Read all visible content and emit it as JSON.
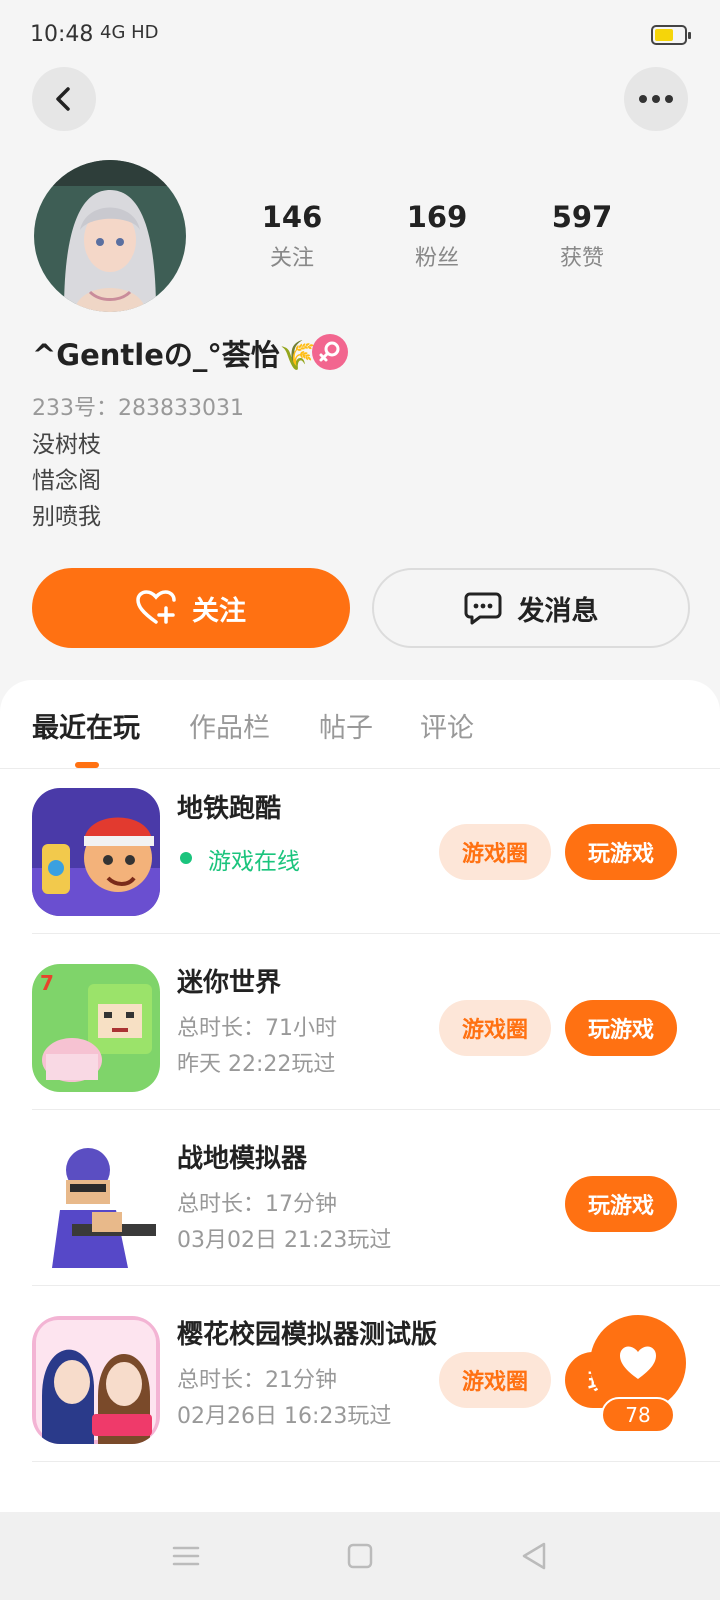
{
  "status_bar": {
    "time": "10:48",
    "network": "4G HD"
  },
  "profile": {
    "stats": [
      {
        "value": "146",
        "label": "关注"
      },
      {
        "value": "169",
        "label": "粉丝"
      },
      {
        "value": "597",
        "label": "获赞"
      }
    ],
    "nickname": "^Gentleの_°荟怡🌾",
    "uid": "233号：283833031",
    "bio": [
      "没树枝",
      "惜念阁",
      "别喷我"
    ],
    "follow_label": "关注",
    "message_label": "发消息"
  },
  "tabs": [
    {
      "label": "最近在玩",
      "active": true
    },
    {
      "label": "作品栏"
    },
    {
      "label": "帖子"
    },
    {
      "label": "评论"
    }
  ],
  "games": [
    {
      "name": "地铁跑酷",
      "status": "游戏在线",
      "circle_label": "游戏圈",
      "play_label": "玩游戏"
    },
    {
      "name": "迷你世界",
      "duration": "总时长：71小时",
      "last_played": "昨天 22:22玩过",
      "circle_label": "游戏圈",
      "play_label": "玩游戏"
    },
    {
      "name": "战地模拟器",
      "duration": "总时长：17分钟",
      "last_played": "03月02日 21:23玩过",
      "play_label": "玩游戏"
    },
    {
      "name": "樱花校园模拟器测试版",
      "duration": "总时长：21分钟",
      "last_played": "02月26日 16:23玩过",
      "circle_label": "游戏圈",
      "play_label": "玩游戏"
    }
  ],
  "like_count": "78",
  "colors": {
    "accent": "#ff7112",
    "online": "#1bc47d",
    "gender": "#f2668f"
  }
}
